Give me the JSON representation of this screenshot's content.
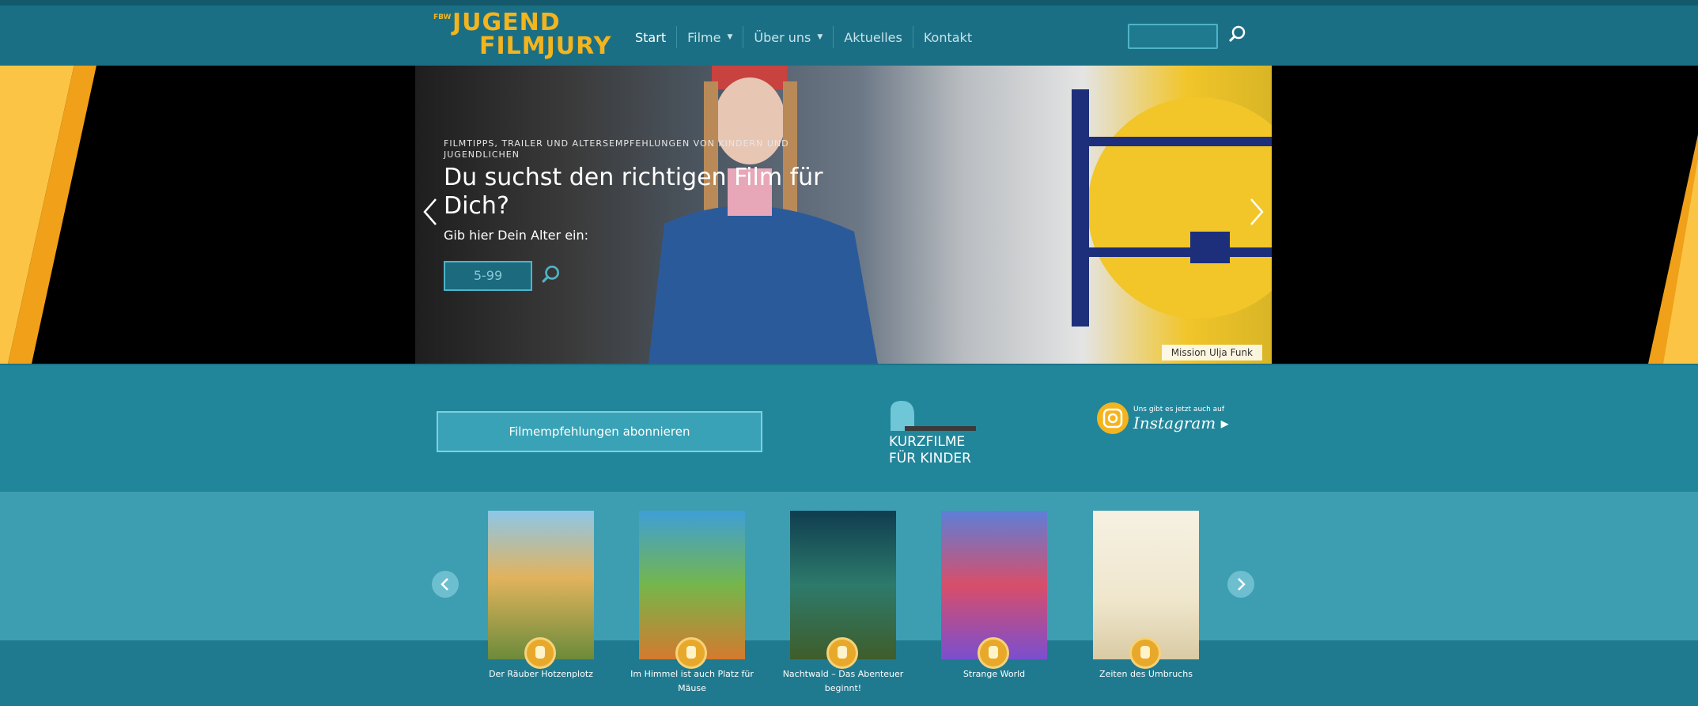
{
  "brand": {
    "prefix": "FBW",
    "line1": "JUGEND",
    "line2": "FILMJURY"
  },
  "nav": [
    {
      "label": "Start",
      "dropdown": false
    },
    {
      "label": "Filme",
      "dropdown": true
    },
    {
      "label": "Über uns",
      "dropdown": true
    },
    {
      "label": "Aktuelles",
      "dropdown": false
    },
    {
      "label": "Kontakt",
      "dropdown": false
    }
  ],
  "hero": {
    "kicker": "FILMTIPPS, TRAILER UND ALTERSEMPFEHLUNGEN VON KINDERN UND JUGENDLICHEN",
    "title": "Du suchst den richtigen Film für Dich?",
    "prompt": "Gib hier Dein Alter ein:",
    "age_placeholder": "5-99",
    "credit": "Mission Ulja Funk"
  },
  "subscribe_label": "Filmempfehlungen abonnieren",
  "kurzfilme": {
    "line1": "KURZFILME",
    "line2": "FÜR KINDER"
  },
  "instagram": {
    "small": "Uns gibt es jetzt auch auf",
    "label": "Instagram ▸"
  },
  "movies": [
    {
      "title": "Der Räuber Hotzenplotz"
    },
    {
      "title": "Im Himmel ist auch Platz für Mäuse"
    },
    {
      "title": "Nachtwald – Das Abenteuer beginnt!"
    },
    {
      "title": "Strange World"
    },
    {
      "title": "Zeiten des Umbruchs"
    }
  ],
  "colors": {
    "accent": "#f4b41d",
    "header": "#1b6f84",
    "band": "#22869b",
    "stripe": "#fbc445"
  }
}
